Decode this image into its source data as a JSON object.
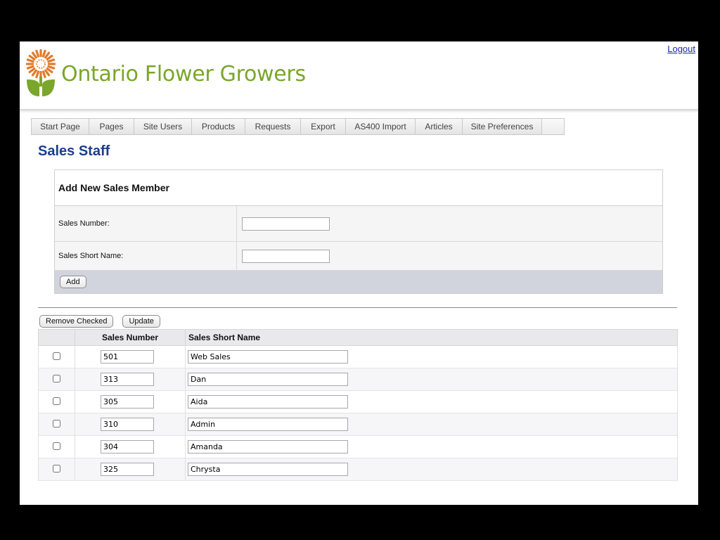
{
  "header": {
    "brand_name": "Ontario Flower Growers",
    "logout_label": "Logout"
  },
  "nav": {
    "tabs": [
      {
        "label": "Start Page"
      },
      {
        "label": "Pages"
      },
      {
        "label": "Site Users"
      },
      {
        "label": "Products"
      },
      {
        "label": "Requests"
      },
      {
        "label": "Export"
      },
      {
        "label": "AS400 Import"
      },
      {
        "label": "Articles"
      },
      {
        "label": "Site Preferences"
      }
    ]
  },
  "page": {
    "title": "Sales Staff"
  },
  "add_form": {
    "heading": "Add New Sales Member",
    "sales_number_label": "Sales Number:",
    "sales_number_value": "",
    "short_name_label": "Sales Short Name:",
    "short_name_value": "",
    "add_button": "Add"
  },
  "list_actions": {
    "remove_button": "Remove Checked",
    "update_button": "Update"
  },
  "staff_table": {
    "columns": [
      "",
      "Sales Number",
      "Sales Short Name"
    ],
    "rows": [
      {
        "checked": false,
        "sales_number": "501",
        "short_name": "Web Sales"
      },
      {
        "checked": false,
        "sales_number": "313",
        "short_name": "Dan"
      },
      {
        "checked": false,
        "sales_number": "305",
        "short_name": "Aida"
      },
      {
        "checked": false,
        "sales_number": "310",
        "short_name": "Admin"
      },
      {
        "checked": false,
        "sales_number": "304",
        "short_name": "Amanda"
      },
      {
        "checked": false,
        "sales_number": "325",
        "short_name": "Chrysta"
      }
    ]
  },
  "colors": {
    "brand_green": "#7aa62b",
    "logo_orange": "#e07a2a",
    "title_blue": "#1b3d8c",
    "link_blue": "#1a2aa8"
  }
}
